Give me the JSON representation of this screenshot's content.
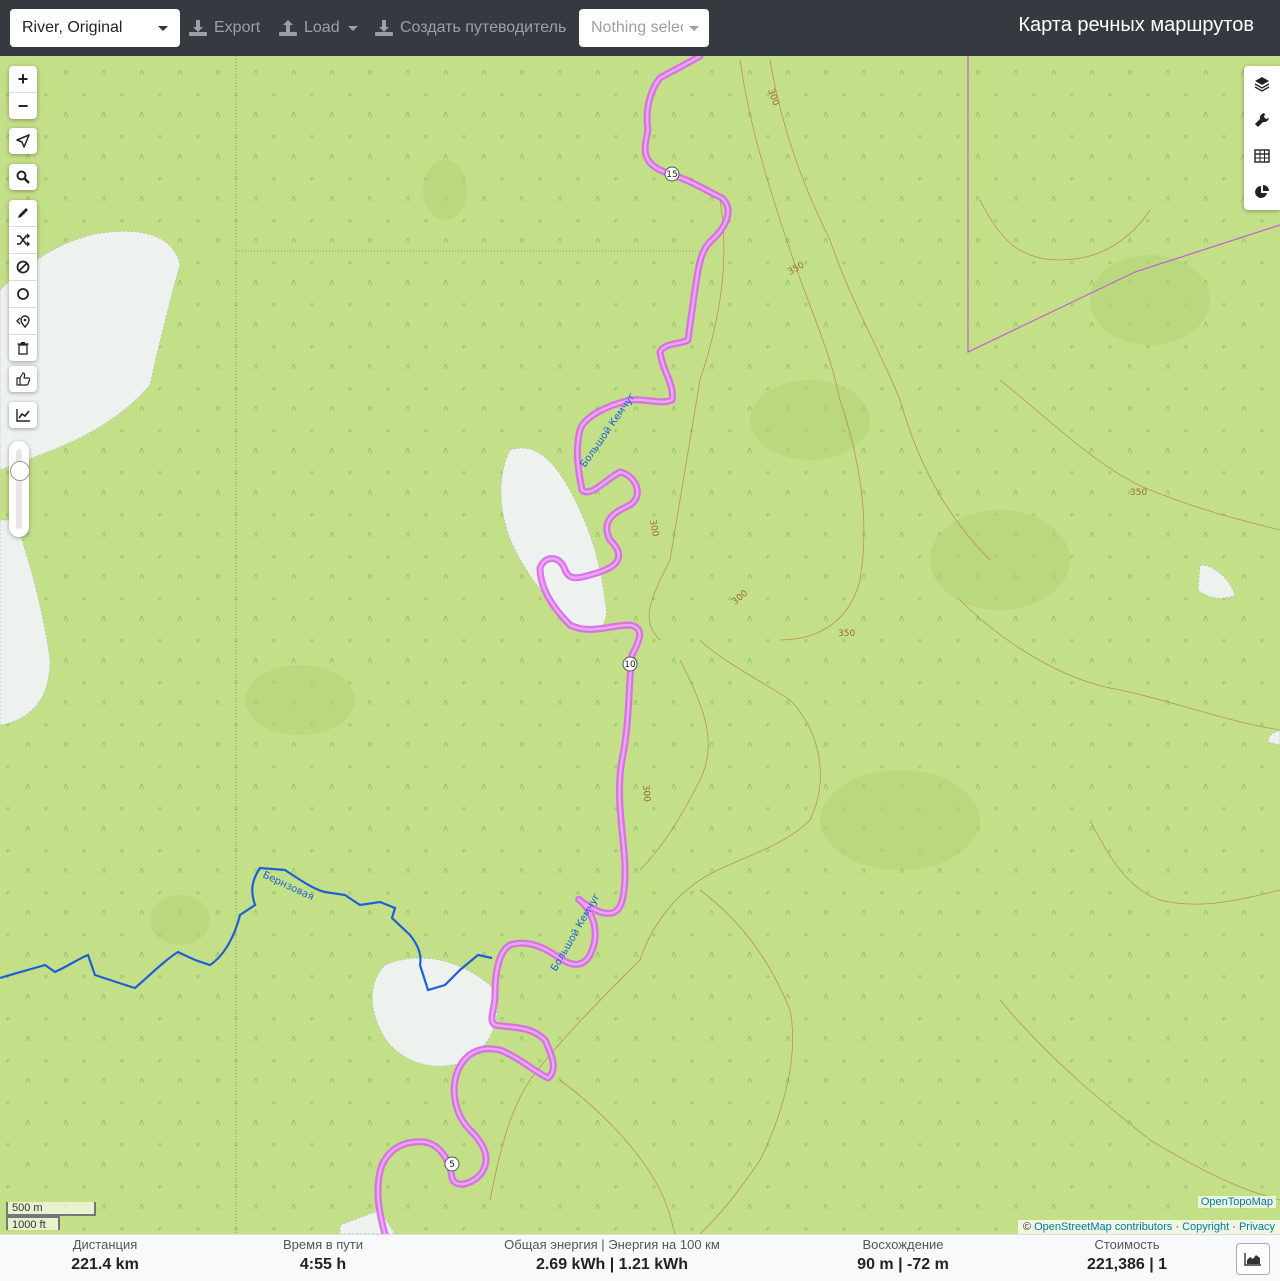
{
  "navbar": {
    "profile_select": "River, Original",
    "export_label": "Export",
    "load_label": "Load",
    "guide_label": "Создать путеводитель",
    "nothing_selected": "Nothing selected",
    "title": "Карта речных маршрутов"
  },
  "map": {
    "zoom_in": "+",
    "zoom_out": "−",
    "waypoints": [
      "15",
      "10",
      "5"
    ],
    "river_labels": [
      "Большой Кемчуг",
      "Большой Кемчуг",
      "Бернзовая"
    ],
    "contour_labels": [
      "300",
      "350",
      "350",
      "300",
      "300",
      "350",
      "300"
    ],
    "scale_metric": "500 m",
    "scale_imperial": "1000 ft",
    "layer_name": "OpenTopoMap",
    "attribution": {
      "prefix": "©",
      "osm": "OpenStreetMap contributors",
      "copyright": "Copyright",
      "privacy": "Privacy",
      "sep": "·"
    },
    "colors": {
      "route": "#d966ea",
      "river": "#1f5fd6",
      "land": "#c3df88",
      "contour": "#b57a4a",
      "boundary": "#c060d0"
    }
  },
  "stats": {
    "distance_label": "Дистанция",
    "distance_value": "221.4 km",
    "time_label": "Время в пути",
    "time_value": "4:55 h",
    "energy_label": "Общая энергия | Энергия на 100 км",
    "energy_value": "2.69 kWh | 1.21 kWh",
    "ascent_label": "Восхождение",
    "ascent_value": "90 m | -72 m",
    "cost_label": "Стоимость",
    "cost_value": "221,386 | 1"
  }
}
